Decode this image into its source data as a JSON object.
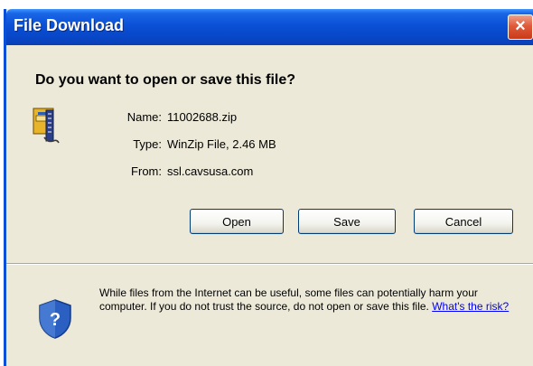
{
  "window": {
    "title": "File Download",
    "close_label": "×"
  },
  "dialog": {
    "question": "Do you want to open or save this file?",
    "file": {
      "name_label": "Name:",
      "name_value": "11002688.zip",
      "type_label": "Type:",
      "type_value": "WinZip File, 2.46 MB",
      "from_label": "From:",
      "from_value": "ssl.cavsusa.com",
      "icon": "winzip-file-icon"
    },
    "buttons": {
      "open": "Open",
      "save": "Save",
      "cancel": "Cancel"
    },
    "warning": {
      "text": "While files from the Internet can be useful, some files can potentially harm your computer. If you do not trust the source, do not open or save this file.",
      "link": "What's the risk?",
      "icon": "shield-question-icon"
    }
  },
  "colors": {
    "titlebar": "#0a50d6",
    "dialog_bg": "#ece9d8",
    "close_button": "#e05a3a",
    "link": "#0000ff"
  }
}
